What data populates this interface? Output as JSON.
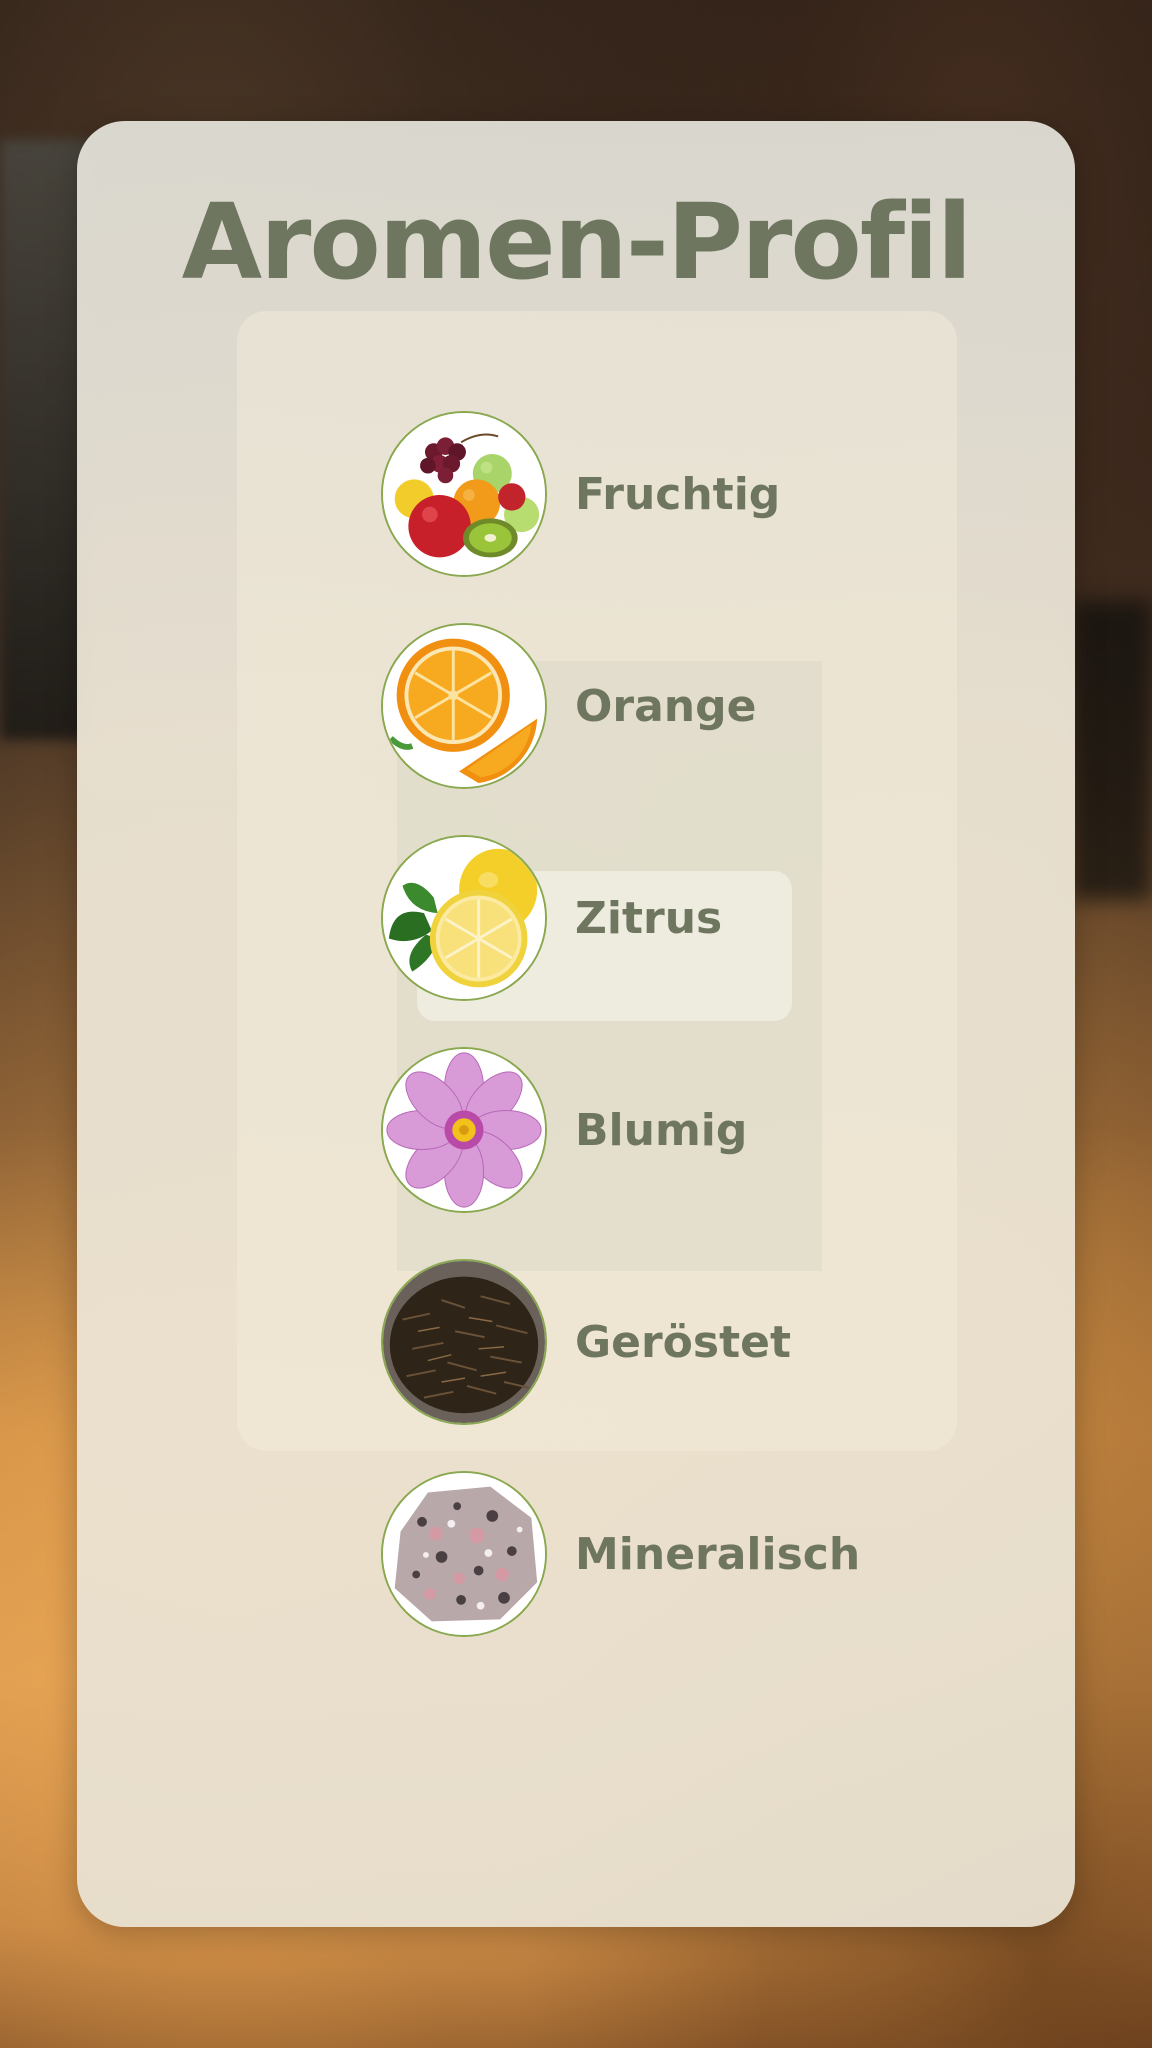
{
  "title": "Aromen-Profil",
  "aromas": [
    {
      "label": "Fruchtig",
      "icon": "mixed-fruit-icon"
    },
    {
      "label": "Orange",
      "icon": "orange-icon"
    },
    {
      "label": "Zitrus",
      "icon": "lemon-icon"
    },
    {
      "label": "Blumig",
      "icon": "flower-icon"
    },
    {
      "label": "Geröstet",
      "icon": "roasted-tea-icon"
    },
    {
      "label": "Mineralisch",
      "icon": "mineral-stone-icon"
    }
  ],
  "colors": {
    "text": "#6f7660",
    "icon_border": "#8aa84f",
    "card": "#ece4d4"
  }
}
